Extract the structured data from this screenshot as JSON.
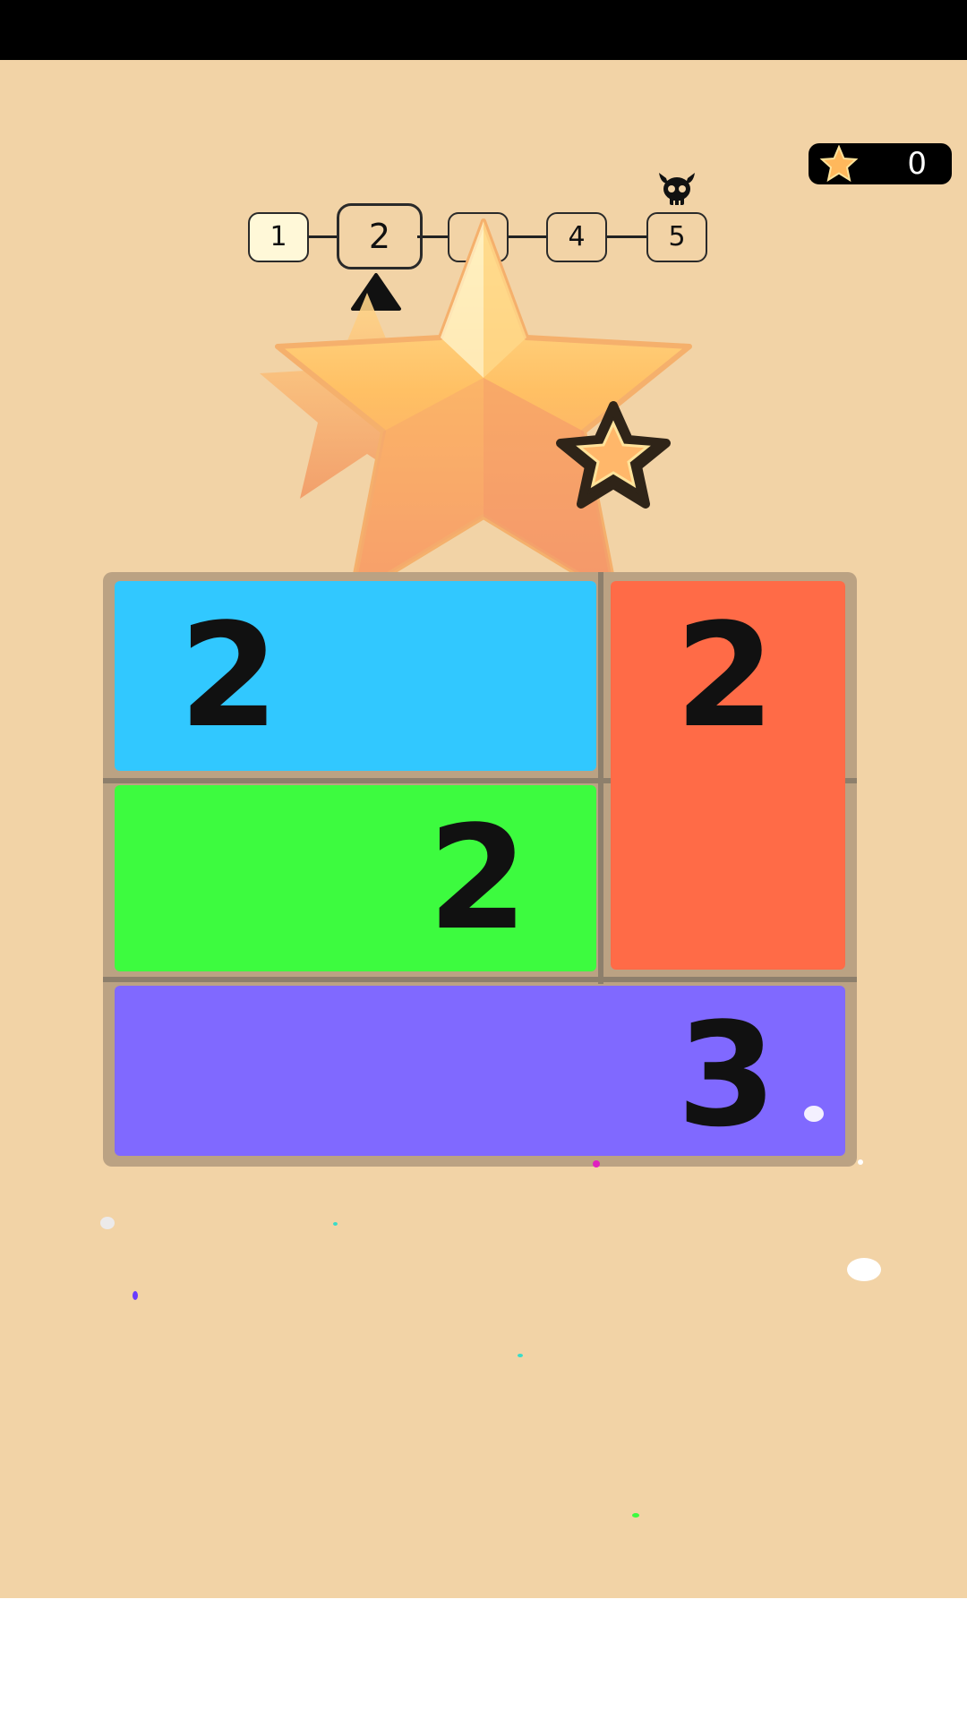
{
  "star_counter": {
    "value": "0",
    "icon": "star-icon"
  },
  "levels": [
    {
      "label": "1",
      "state": "done"
    },
    {
      "label": "2",
      "state": "current"
    },
    {
      "label": "",
      "state": "hidden"
    },
    {
      "label": "4",
      "state": "locked"
    },
    {
      "label": "5",
      "state": "boss"
    }
  ],
  "boss_icon": "horned-skull-icon",
  "blocks": [
    {
      "value": "2",
      "color": "#31c8ff"
    },
    {
      "value": "2",
      "color": "#ff6b47"
    },
    {
      "value": "2",
      "color": "#3dfb3f"
    },
    {
      "value": "3",
      "color": "#8069ff"
    }
  ],
  "colors": {
    "background": "#f2d3a6",
    "board": "#bba283"
  }
}
